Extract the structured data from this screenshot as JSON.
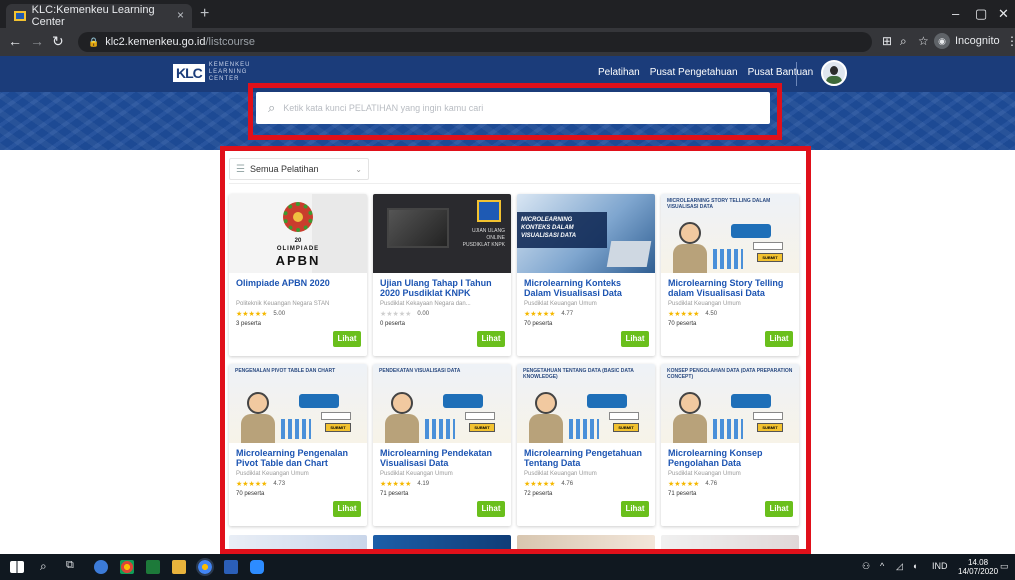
{
  "browser": {
    "tab_title": "KLC:Kemenkeu Learning Center",
    "tab_close": "×",
    "new_tab": "+",
    "url_domain": "klc2.kemenkeu.go.id",
    "url_path": "/listcourse",
    "incognito_label": "Incognito",
    "window_controls": [
      "–",
      "▢",
      "✕"
    ]
  },
  "site": {
    "logo_mark": "KLC",
    "logo_wordmark": [
      "KEMENKEU",
      "LEARNING",
      "CENTER"
    ],
    "nav": [
      "Pelatihan",
      "Pusat Pengetahuan",
      "Pusat Bantuan"
    ],
    "search_placeholder": "Ketik kata kunci PELATIHAN yang ingin kamu cari",
    "filter_value": "Semua Pelatihan"
  },
  "courses": [
    {
      "title": "Olimpiade APBN 2020",
      "org": "Politeknik Keuangan Negara STAN",
      "stars": "★★★★★",
      "rating": "5.00",
      "participants": "3 peserta",
      "button": "Lihat",
      "art": "apbn",
      "art_text": [
        "20",
        "OLIMPIADE",
        "APBN"
      ]
    },
    {
      "title": "Ujian Ulang Tahap I Tahun 2020 Pusdiklat KNPK",
      "org": "Pusdiklat Kekayaan Negara dan...",
      "stars": "★★★★★",
      "rating": "0.00",
      "participants": "0 peserta",
      "button": "Lihat",
      "art": "dark",
      "art_text": [
        "UJIAN ULANG",
        "ONLINE",
        "PUSDIKLAT KNPK"
      ]
    },
    {
      "title": "Microlearning Konteks Dalam Visualisasi Data",
      "org": "Pusdiklat Keuangan Umum",
      "stars": "★★★★★",
      "rating": "4.77",
      "participants": "70 peserta",
      "button": "Lihat",
      "art": "blue",
      "art_text": [
        "MICROLEARNING",
        "KONTEKS DALAM",
        "VISUALISASI DATA"
      ]
    },
    {
      "title": "Microlearning Story Telling dalam Visualisasi Data",
      "org": "Pusdiklat Keuangan Umum",
      "stars": "★★★★★",
      "rating": "4.50",
      "participants": "70 peserta",
      "button": "Lihat",
      "art": "cartoon",
      "art_text": [
        "MICROLEARNING STORY TELLING DALAM VISUALISASI DATA",
        "SUBMIT"
      ]
    },
    {
      "title": "Microlearning Pengenalan Pivot Table dan Chart",
      "org": "Pusdiklat Keuangan Umum",
      "stars": "★★★★★",
      "rating": "4.73",
      "participants": "70 peserta",
      "button": "Lihat",
      "art": "cartoon",
      "art_text": [
        "PENGENALAN PIVOT TABLE DAN CHART",
        "SUBMIT"
      ]
    },
    {
      "title": "Microlearning Pendekatan Visualisasi Data",
      "org": "Pusdiklat Keuangan Umum",
      "stars": "★★★★★",
      "rating": "4.19",
      "participants": "71 peserta",
      "button": "Lihat",
      "art": "cartoon",
      "art_text": [
        "PENDEKATAN VISUALISASI DATA",
        "SUBMIT"
      ]
    },
    {
      "title": "Microlearning Pengetahuan Tentang Data",
      "org": "Pusdiklat Keuangan Umum",
      "stars": "★★★★★",
      "rating": "4.76",
      "participants": "72 peserta",
      "button": "Lihat",
      "art": "cartoon",
      "art_text": [
        "PENGETAHUAN TENTANG DATA (BASIC DATA KNOWLEDGE)",
        "SUBMIT"
      ]
    },
    {
      "title": "Microlearning Konsep Pengolahan Data",
      "org": "Pusdiklat Keuangan Umum",
      "stars": "★★★★★",
      "rating": "4.76",
      "participants": "71 peserta",
      "button": "Lihat",
      "art": "cartoon",
      "art_text": [
        "KONSEP PENGOLAHAN DATA (DATA PREPARATION CONCEPT)",
        "SUBMIT"
      ]
    }
  ],
  "taskbar": {
    "lang": "IND",
    "time": "14.08",
    "date": "14/07/2020"
  },
  "colors": {
    "header": "#1b3c7a",
    "title_link": "#1c54b2",
    "star": "#f5b800",
    "star_empty": "#cfcfcf",
    "button": "#6abf1c",
    "highlight": "#e0101a"
  }
}
